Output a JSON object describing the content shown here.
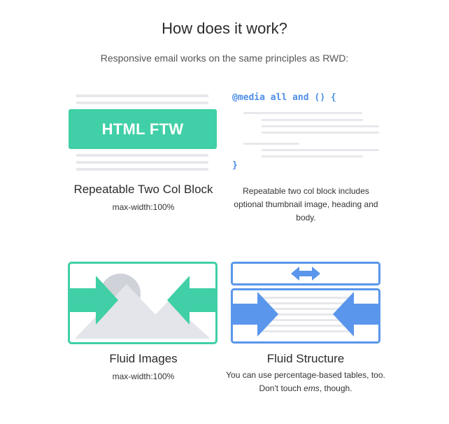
{
  "header": {
    "title": "How does it work?",
    "subtitle": "Responsive email works on the same principles as RWD:"
  },
  "block_two_col": {
    "button_text": "HTML FTW",
    "label": "Repeatable Two Col Block",
    "sublabel": "max-width:100%"
  },
  "code_sample": {
    "open": "@media all and () {",
    "close": "}",
    "description": "Repeatable two col block includes optional thumbnail image, heading and body."
  },
  "fluid_images": {
    "label": "Fluid Images",
    "sublabel": "max-width:100%"
  },
  "fluid_structure": {
    "label": "Fluid Structure",
    "description_prefix": "You can use percentage-based tables, too. Don't touch ",
    "description_em": "ems",
    "description_suffix": ", though."
  },
  "colors": {
    "green": "#40cfa6",
    "blue": "#5a96eb",
    "line_gray": "#e7e8ec",
    "mountain_gray": "#e3e5ea",
    "sun_gray": "#cfd2d9"
  }
}
